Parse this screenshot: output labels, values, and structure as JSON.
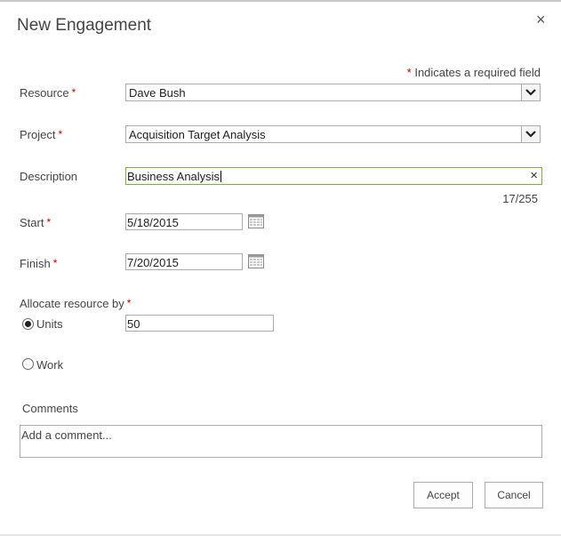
{
  "dialog": {
    "title": "New Engagement",
    "close_icon": "×",
    "required_note": "Indicates a required field",
    "required_marker": "*"
  },
  "fields": {
    "resource": {
      "label": "Resource",
      "value": "Dave Bush",
      "required": true
    },
    "project": {
      "label": "Project",
      "value": "Acquisition Target Analysis",
      "required": true
    },
    "description": {
      "label": "Description",
      "value": "Business Analysis",
      "counter": "17/255",
      "clear_icon": "×"
    },
    "start": {
      "label": "Start",
      "value": "5/18/2015",
      "required": true
    },
    "finish": {
      "label": "Finish",
      "value": "7/20/2015",
      "required": true
    },
    "allocate": {
      "label": "Allocate resource by",
      "required": true,
      "options": [
        {
          "label": "Units",
          "selected": true
        },
        {
          "label": "Work",
          "selected": false
        }
      ],
      "units_value": "50"
    },
    "comments": {
      "label": "Comments",
      "placeholder": "Add a comment..."
    }
  },
  "buttons": {
    "accept": "Accept",
    "cancel": "Cancel"
  },
  "colors": {
    "required": "#bf0000",
    "active_border": "#7cae3c"
  }
}
